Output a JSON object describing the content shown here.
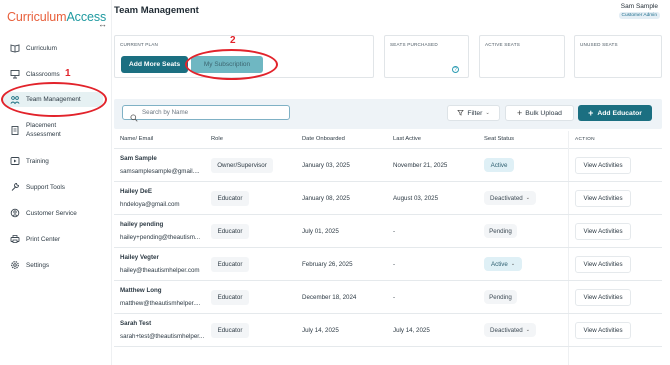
{
  "app": {
    "logo_part1": "Curriculum",
    "logo_part2": "Access",
    "collapse_glyph": "↔"
  },
  "sidebar": {
    "items": [
      {
        "label": "Curriculum",
        "icon": "book-icon"
      },
      {
        "label": "Classrooms",
        "icon": "board-icon"
      },
      {
        "label": "Team Management",
        "icon": "team-icon",
        "active": true
      },
      {
        "label": "Placement Assessment",
        "icon": "clipboard-icon"
      },
      {
        "label": "Training",
        "icon": "play-icon"
      },
      {
        "label": "Support Tools",
        "icon": "tools-icon"
      },
      {
        "label": "Customer Service",
        "icon": "support-icon"
      },
      {
        "label": "Print Center",
        "icon": "printer-icon"
      },
      {
        "label": "Settings",
        "icon": "gear-icon"
      }
    ]
  },
  "header": {
    "title": "Team Management",
    "user_name": "Sam Sample",
    "user_role": "Customer Admin"
  },
  "plan": {
    "current_plan_caption": "CURRENT PLAN",
    "add_more_seats_label": "Add More Seats",
    "my_subscription_label": "My Subscription",
    "seats_purchased_caption": "SEATS PURCHASED",
    "active_seats_caption": "ACTIVE SEATS",
    "unused_seats_caption": "UNUSED SEATS",
    "help_glyph": "?"
  },
  "annotations": {
    "num1": "1",
    "num2": "2",
    "color": "#e2232b"
  },
  "toolbar": {
    "search_placeholder": "Search by Name",
    "filter_label": "Filter",
    "bulk_upload_label": "Bulk Upload",
    "add_educator_label": "Add Educator"
  },
  "table": {
    "headers": {
      "name": "Name/ Email",
      "role": "Role",
      "date_onboarded": "Date Onboarded",
      "last_active": "Last Active",
      "seat_status": "Seat Status",
      "action": "ACTION"
    },
    "rows": [
      {
        "name": "Sam Sample",
        "email": "samsamplesample@gmail....",
        "role": "Owner/Supervisor",
        "date_onboarded": "January 03, 2025",
        "last_active": "November 21, 2025",
        "status": "Active",
        "status_kind": "active",
        "dropdown": false,
        "action": "View Activities"
      },
      {
        "name": "Hailey DeE",
        "email": "hndeloya@gmail.com",
        "role": "Educator",
        "date_onboarded": "January 08, 2025",
        "last_active": "August 03, 2025",
        "status": "Deactivated",
        "status_kind": "deact",
        "dropdown": true,
        "action": "View Activities"
      },
      {
        "name": "hailey pending",
        "email": "hailey+pending@theautism...",
        "role": "Educator",
        "date_onboarded": "July 01, 2025",
        "last_active": "-",
        "status": "Pending",
        "status_kind": "pend",
        "dropdown": false,
        "action": "View Activities"
      },
      {
        "name": "Hailey Vegter",
        "email": "hailey@theautismhelper.com",
        "role": "Educator",
        "date_onboarded": "February 26, 2025",
        "last_active": "-",
        "status": "Active",
        "status_kind": "active",
        "dropdown": true,
        "action": "View Activities"
      },
      {
        "name": "Matthew Long",
        "email": "matthew@theautismhelper....",
        "role": "Educator",
        "date_onboarded": "December 18, 2024",
        "last_active": "-",
        "status": "Pending",
        "status_kind": "pend",
        "dropdown": false,
        "action": "View Activities"
      },
      {
        "name": "Sarah Test",
        "email": "sarah+test@theautismhelper...",
        "role": "Educator",
        "date_onboarded": "July 14, 2025",
        "last_active": "July 14, 2025",
        "status": "Deactivated",
        "status_kind": "deact",
        "dropdown": true,
        "action": "View Activities"
      }
    ]
  }
}
